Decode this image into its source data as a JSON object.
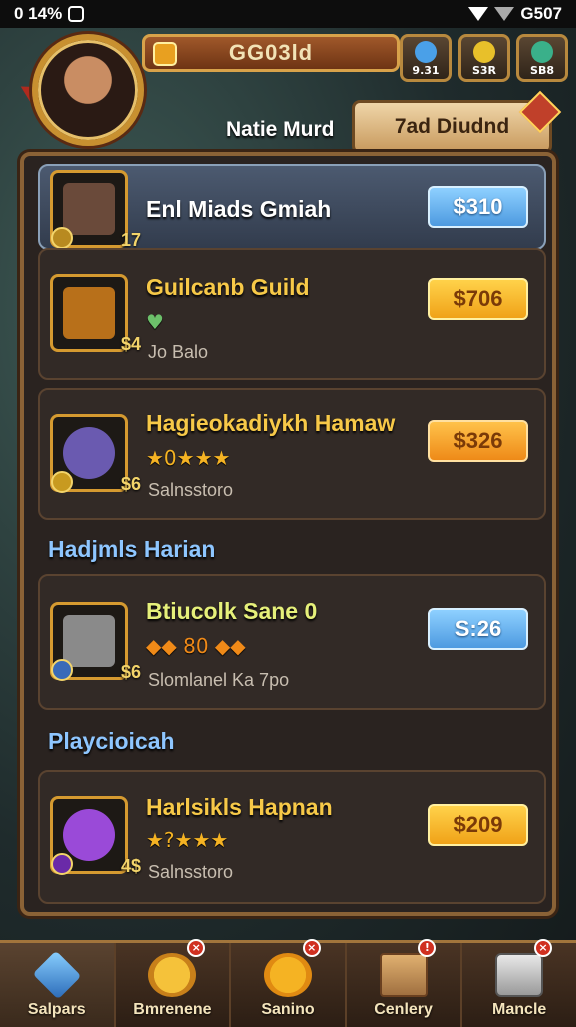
{
  "status_bar": {
    "left": "0 14%",
    "right": "G507"
  },
  "header": {
    "gold_label": "GG03ld",
    "player_name": "Natie Murd",
    "top_tab": "7ad Diudnd",
    "resources": [
      {
        "label": "9.31",
        "icon": "blue-gem-icon",
        "color": "#4aa0e8"
      },
      {
        "label": "S3R",
        "icon": "gold-gem-icon",
        "color": "#e8c02a"
      },
      {
        "label": "SB8",
        "icon": "green-gem-icon",
        "color": "#3ab08a"
      }
    ]
  },
  "cards": [
    {
      "title": "Enl Miads Gmiah",
      "title_color": "#ffffff",
      "price": "$310",
      "price_style": "blue",
      "thumb_num": "17",
      "thumb_icon": "hero-portrait-icon",
      "art_color": "#6a4a3a"
    },
    {
      "title": "Guilcanb Guild",
      "title_color": "#f7c948",
      "sub": "Jo Balo",
      "extra": "♥",
      "price": "$706",
      "price_style": "orange",
      "thumb_num": "$4",
      "thumb_icon": "treasure-chest-icon",
      "art_color": "#b8701a"
    },
    {
      "title": "Hagieokadiykh Hamaw",
      "title_color": "#f7c948",
      "stars": "★0★★★",
      "sub": "Salnsstoro",
      "price": "$326",
      "price_style": "orange2",
      "thumb_num": "$6",
      "thumb_icon": "spiked-orb-icon",
      "art_color": "#6a5ab0"
    },
    {
      "title": "Btiucolk Sane 0",
      "title_color": "#e6f07a",
      "stars": "◆◆ 80 ◆◆",
      "sub": "Slomlanel Ka 7po",
      "price": "S:26",
      "price_style": "blue",
      "thumb_num": "$6",
      "thumb_icon": "cannon-icon",
      "art_color": "#8a8a8a"
    },
    {
      "title": "Harlsikls Hapnan",
      "title_color": "#f7c948",
      "stars": "★?★★★",
      "sub": "Salnsstoro",
      "price": "$209",
      "price_style": "orange",
      "thumb_num": "4$",
      "thumb_icon": "purple-orb-icon",
      "art_color": "#9a4ad8"
    }
  ],
  "sections": [
    "Hadjmls Harian",
    "Playcioicah"
  ],
  "bottom_nav": [
    {
      "label": "Salpars",
      "icon": "crystal-icon",
      "active": true,
      "alert": ""
    },
    {
      "label": "Bmrenene",
      "icon": "sun-face-icon",
      "active": false,
      "alert": "×"
    },
    {
      "label": "Sanino",
      "icon": "sun-icon",
      "active": false,
      "alert": "×"
    },
    {
      "label": "Cenlery",
      "icon": "scroll-map-icon",
      "active": false,
      "alert": "!"
    },
    {
      "label": "Mancle",
      "icon": "chest-icon",
      "active": false,
      "alert": "×"
    }
  ]
}
